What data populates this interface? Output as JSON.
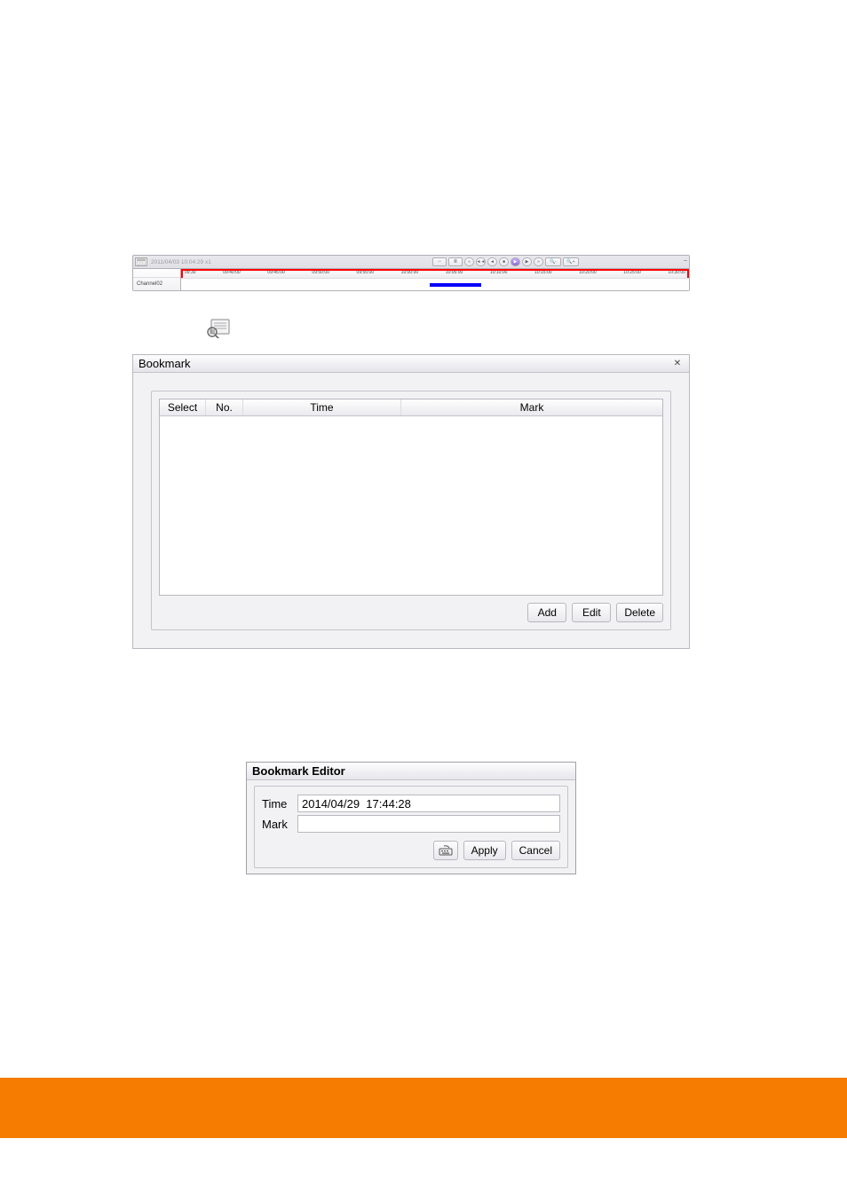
{
  "timeline": {
    "timestamp": "2011/04/03 10:04:29 x1",
    "channel_label": "Channel02",
    "ticks": [
      "09:30",
      "09:40:00",
      "09:45:00",
      "09:50:00",
      "09:55:00",
      "10:00:00",
      "10:05:00",
      "10:10:00",
      "10:15:00",
      "10:20:00",
      "10:25:00",
      "10:30:00"
    ]
  },
  "bookmark_dialog": {
    "title": "Bookmark",
    "columns": {
      "select": "Select",
      "no": "No.",
      "time": "Time",
      "mark": "Mark"
    },
    "buttons": {
      "add": "Add",
      "edit": "Edit",
      "delete": "Delete"
    }
  },
  "bookmark_editor": {
    "title": "Bookmark Editor",
    "time_label": "Time",
    "time_value": "2014/04/29  17:44:28",
    "mark_label": "Mark",
    "mark_value": "",
    "buttons": {
      "apply": "Apply",
      "cancel": "Cancel"
    }
  }
}
